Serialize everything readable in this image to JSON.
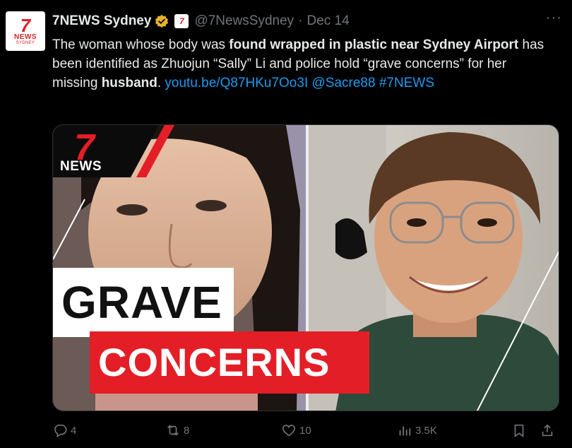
{
  "tweet": {
    "display_name": "7NEWS Sydney",
    "handle": "@7NewsSydney",
    "separator": "·",
    "date": "Dec 14",
    "more_label": "···",
    "text": {
      "p1": "The woman whose body was ",
      "b1": "found wrapped in plastic near Sydney Airport",
      "p2": " has been identified as Zhuojun “Sally” Li and police hold “grave concerns” for her missing ",
      "b2": "husband",
      "p3": ". ",
      "link": "youtu.be/Q87HKu7Oo3I",
      "mention": "@Sacre88",
      "hashtag": "#7NEWS"
    }
  },
  "avatar": {
    "seven": "7",
    "news": "NEWS",
    "sub": "SYDNEY"
  },
  "affiliate_badge": {
    "text": "7"
  },
  "media": {
    "logo_seven": "7",
    "logo_news": "NEWS",
    "headline_line1": "GRAVE",
    "headline_line2": "CONCERNS"
  },
  "actions": {
    "replies": "4",
    "reposts": "8",
    "likes": "10",
    "views": "3.5K"
  },
  "colors": {
    "background": "#000000",
    "text": "#e7e9ea",
    "muted": "#71767b",
    "link": "#1d9bf0",
    "brand_red": "#e41e26",
    "verified_gold": "#e8b327"
  }
}
